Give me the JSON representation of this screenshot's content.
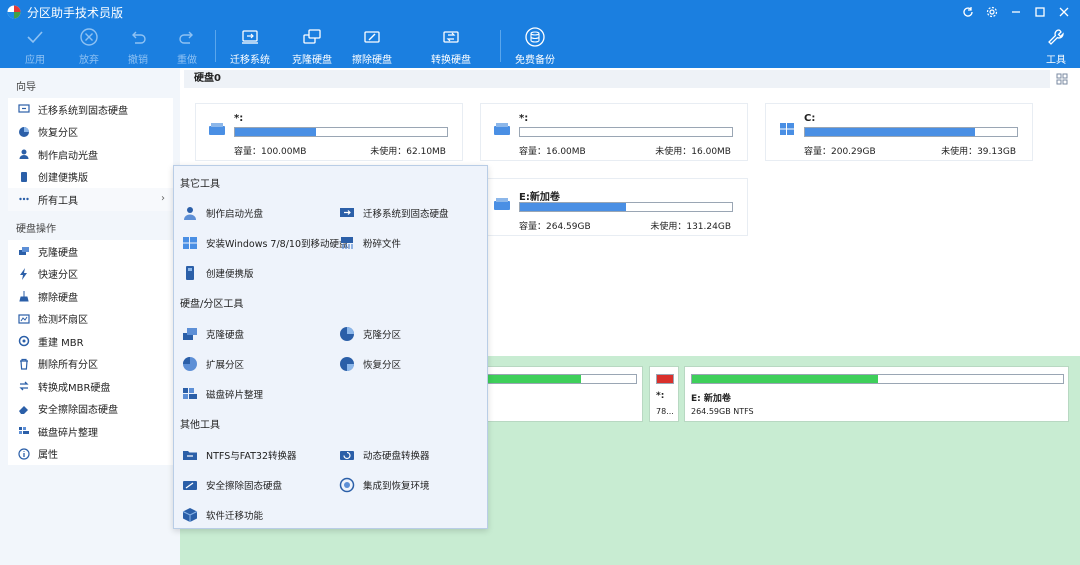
{
  "window": {
    "title": "分区助手技术员版",
    "controls": [
      "refresh-icon",
      "gear-icon",
      "minimize-icon",
      "maximize-icon",
      "close-icon"
    ]
  },
  "toolbar": {
    "apply": "应用",
    "discard": "放弃",
    "undo": "撤销",
    "redo": "重做",
    "migrate_os": "迁移系统",
    "clone_disk": "克隆硬盘",
    "wipe_disk": "擦除硬盘",
    "convert_disk": "转换硬盘",
    "free_backup": "免费备份",
    "tools": "工具"
  },
  "sidebar": {
    "wizard_title": "向导",
    "wizard_items": [
      "迁移系统到固态硬盘",
      "恢复分区",
      "制作启动光盘",
      "创建便携版",
      "所有工具"
    ],
    "disk_ops_title": "硬盘操作",
    "disk_ops_items": [
      "克隆硬盘",
      "快速分区",
      "擦除硬盘",
      "检测坏扇区",
      "重建 MBR",
      "删除所有分区",
      "转换成MBR硬盘",
      "安全擦除固态硬盘",
      "磁盘碎片整理",
      "属性"
    ]
  },
  "disk": {
    "header": "硬盘0",
    "partitions": [
      {
        "name": "*:",
        "capacity": "容量：100.00MB",
        "free": "未使用：62.10MB",
        "used_fraction": 0.38
      },
      {
        "name": "*:",
        "capacity": "容量：16.00MB",
        "free": "未使用：16.00MB",
        "used_fraction": 0.0
      },
      {
        "name": "C:",
        "capacity": "容量：200.29GB",
        "free": "未使用：39.13GB",
        "used_fraction": 0.8
      },
      {
        "name": "E:新加卷",
        "capacity": "容量：264.59GB",
        "free": "未使用：131.24GB",
        "used_fraction": 0.5
      }
    ]
  },
  "lower": {
    "small_name": "*:",
    "small_info": "78...",
    "e_name": "E: 新加卷",
    "e_info": "264.59GB NTFS"
  },
  "popup": {
    "other_tools_title": "其它工具",
    "other_tools": [
      "制作启动光盘",
      "迁移系统到固态硬盘",
      "安装Windows 7/8/10到移动硬盘",
      "粉碎文件",
      "创建便携版"
    ],
    "disk_tools_title": "硬盘/分区工具",
    "disk_tools": [
      "克隆硬盘",
      "克隆分区",
      "扩展分区",
      "恢复分区",
      "磁盘碎片整理"
    ],
    "misc_tools_title": "其他工具",
    "misc_tools": [
      "NTFS与FAT32转换器",
      "动态硬盘转换器",
      "安全擦除固态硬盘",
      "集成到恢复环境",
      "软件迁移功能"
    ]
  },
  "colors": {
    "brand_blue": "#1b7fe0",
    "bar_blue": "#4a8fe4",
    "bar_green": "#3ecf5a",
    "bar_red": "#d9302c",
    "lower_bg": "#c8ecd2"
  }
}
